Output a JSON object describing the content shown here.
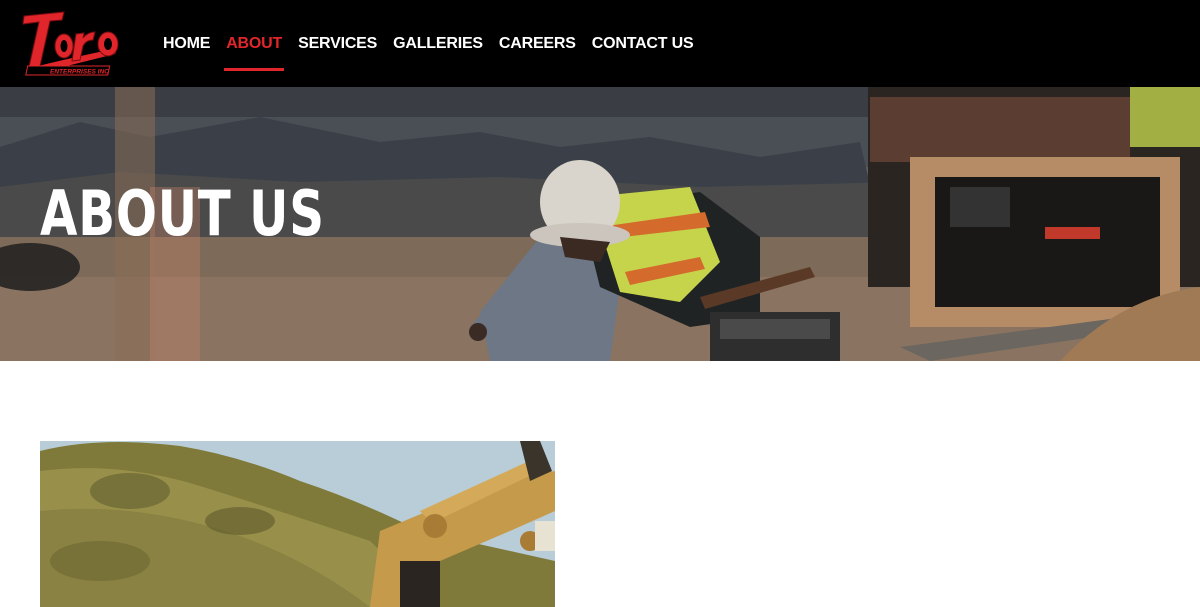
{
  "brand": {
    "logo_text": "Toro",
    "logo_subtext": "ENTERPRISES INC",
    "accent_color": "#e0262b"
  },
  "nav": {
    "items": [
      {
        "label": "HOME",
        "active": false
      },
      {
        "label": "ABOUT",
        "active": true
      },
      {
        "label": "SERVICES",
        "active": false
      },
      {
        "label": "GALLERIES",
        "active": false
      },
      {
        "label": "CAREERS",
        "active": false
      },
      {
        "label": "CONTACT US",
        "active": false
      }
    ]
  },
  "hero": {
    "title": "ABOUT US",
    "image_subject": "construction worker in hard hat and safety vest"
  },
  "content": {
    "image_subject": "excavator arm on grassy hillside"
  }
}
